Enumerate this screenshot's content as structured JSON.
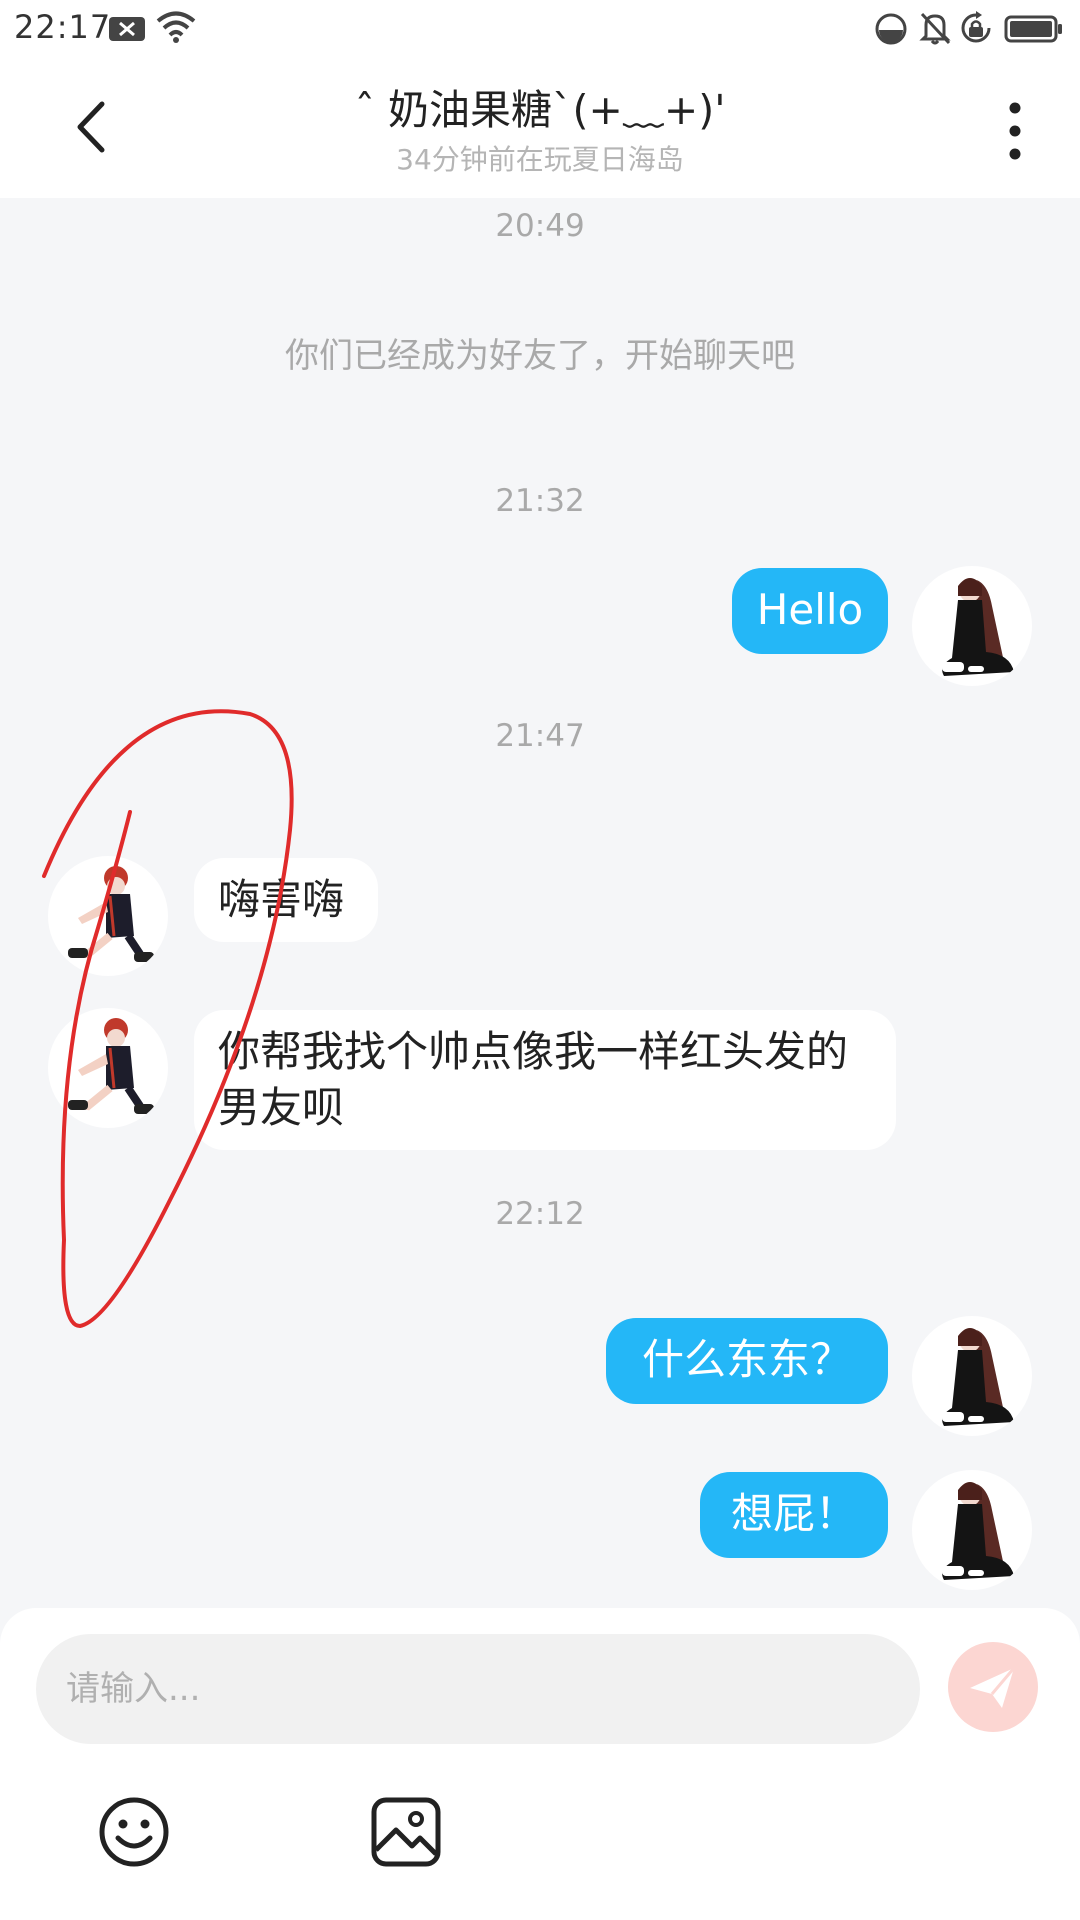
{
  "status_bar": {
    "time": "22:17",
    "icons": [
      "notification-x-icon",
      "wifi-icon",
      "data-saver-icon",
      "bell-muted-icon",
      "rotation-lock-icon",
      "battery-icon"
    ]
  },
  "header": {
    "back_icon": "chevron-left-icon",
    "name": "ˆ 奶油果糖`(+﹏+)'",
    "status": "34分钟前在玩夏日海岛",
    "more_icon": "more-vertical-icon"
  },
  "chat": {
    "items": [
      {
        "type": "timestamp",
        "text": "20:49"
      },
      {
        "type": "system",
        "text": "你们已经成为好友了，开始聊天吧"
      },
      {
        "type": "timestamp",
        "text": "21:32"
      },
      {
        "type": "message",
        "side": "out",
        "text": "Hello"
      },
      {
        "type": "timestamp",
        "text": "21:47"
      },
      {
        "type": "message",
        "side": "in",
        "text": "嗨害嗨"
      },
      {
        "type": "message",
        "side": "in",
        "text": "你帮我找个帅点像我一样红头发的男友呗"
      },
      {
        "type": "timestamp",
        "text": "22:12"
      },
      {
        "type": "message",
        "side": "out",
        "text": "什么东东？"
      },
      {
        "type": "message",
        "side": "out",
        "text": "想屁！"
      }
    ]
  },
  "input": {
    "placeholder": "请输入...",
    "send_icon": "send-paper-plane-icon",
    "tools": [
      "emoji-icon",
      "image-icon"
    ]
  },
  "colors": {
    "outgoing_bubble": "#24b7f7",
    "incoming_bubble": "#ffffff",
    "chat_background": "#f5f6f8",
    "send_button": "#fcd6d2",
    "annotation_stroke": "#e02b2b"
  }
}
